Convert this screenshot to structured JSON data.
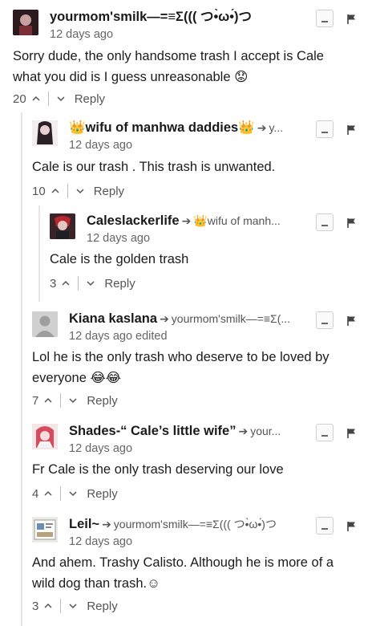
{
  "comments": [
    {
      "author": "yourmom'smilk—=≡Σ((( つ•̀ω•́)つ",
      "reply_to": "",
      "timestamp": "12 days ago",
      "edited": "",
      "body_lines": [
        "Sorry dude, the only handsome trash I accept is Cale",
        "what you did is I guess unreasonable 😟"
      ],
      "votes": "20",
      "reply_label": "Reply",
      "avatar_color": "#4a2a2e"
    },
    {
      "author": "👑wifu of manhwa daddies👑",
      "reply_to": "y...",
      "timestamp": "12 days ago",
      "edited": "",
      "body_lines": [
        "Cale is our trash . This trash is unwanted."
      ],
      "votes": "10",
      "reply_label": "Reply",
      "avatar_color": "#3a2f3a"
    },
    {
      "author": "Caleslackerlife",
      "reply_to": "👑wifu of manh...",
      "timestamp": "12 days ago",
      "edited": "",
      "body_lines": [
        "Cale is the golden trash"
      ],
      "votes": "3",
      "reply_label": "Reply",
      "avatar_color": "#5a2a30"
    },
    {
      "author": "Kiana kaslana",
      "reply_to": "yourmom'smilk—=≡Σ(...",
      "timestamp": "12 days ago",
      "edited": "edited",
      "body_lines": [
        "Lol he is the only trash who deserve to be loved by",
        "everyone 😂😂"
      ],
      "votes": "7",
      "reply_label": "Reply",
      "avatar_color": "#c9c9c9"
    },
    {
      "author": "Shades-“ Cale’s little wife”",
      "reply_to": "your...",
      "timestamp": "12 days ago",
      "edited": "",
      "body_lines": [
        "Fr Cale is the only trash deserving our love"
      ],
      "votes": "4",
      "reply_label": "Reply",
      "avatar_color": "#b53a4a"
    },
    {
      "author": "Leil~",
      "reply_to": "yourmom'smilk—=≡Σ((( つ•̀ω•́)つ",
      "timestamp": "12 days ago",
      "edited": "",
      "body_lines": [
        "And ahem. Trashy Calisto. Although he is more of a",
        "wild dog than trash.☺"
      ],
      "votes": "3",
      "reply_label": "Reply",
      "avatar_color": "#d8d4c8"
    }
  ],
  "icons": {
    "arrow": "reply-arrow-icon",
    "upvote": "chevron-up-icon",
    "downvote": "chevron-down-icon",
    "collapse": "minus-icon",
    "flag": "flag-icon"
  },
  "colors": {
    "text": "#1b1b1b",
    "meta": "#666666",
    "line": "#e6e6e6"
  }
}
